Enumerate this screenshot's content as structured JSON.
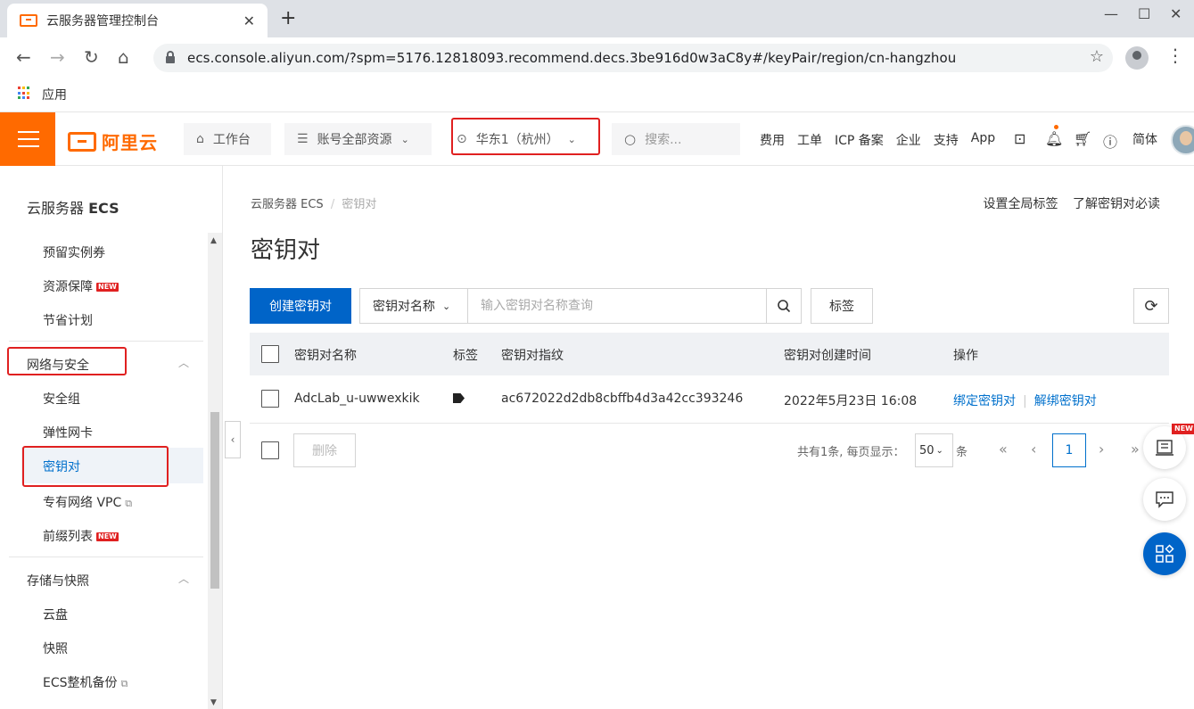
{
  "browser": {
    "tab_title": "云服务器管理控制台",
    "tab_close": "✕",
    "new_tab": "+",
    "url": "ecs.console.aliyun.com/?spm=5176.12818093.recommend.decs.3be916d0w3aC8y#/keyPair/region/cn-hangzhou",
    "bookmark_apps": "应用"
  },
  "topnav": {
    "logo_text": "阿里云",
    "workbench": "工作台",
    "resources": "账号全部资源",
    "region": "华东1（杭州）",
    "search_placeholder": "搜索...",
    "links": [
      "费用",
      "工单",
      "ICP 备案",
      "企业",
      "支持",
      "App"
    ],
    "lang": "简体"
  },
  "sidebar": {
    "title_prefix": "云服务器",
    "title_bold": "ECS",
    "items": {
      "reserved": "预留实例券",
      "resource_guarantee": "资源保障",
      "saving_plan": "节省计划",
      "network_security": "网络与安全",
      "security_group": "安全组",
      "eni": "弹性网卡",
      "key_pair": "密钥对",
      "vpc": "专有网络 VPC",
      "prefix_list": "前缀列表",
      "storage": "存储与快照",
      "disk": "云盘",
      "snapshot": "快照",
      "ecs_backup": "ECS整机备份"
    },
    "new_badge": "NEW"
  },
  "main": {
    "breadcrumb_root": "云服务器 ECS",
    "breadcrumb_sep": "/",
    "breadcrumb_current": "密钥对",
    "top_link_1": "设置全局标签",
    "top_link_2": "了解密钥对必读",
    "page_title": "密钥对",
    "create_button": "创建密钥对",
    "search_field": "密钥对名称",
    "search_placeholder": "输入密钥对名称查询",
    "tag_button": "标签",
    "refresh_icon": "⟳",
    "columns": {
      "name": "密钥对名称",
      "tag": "标签",
      "fingerprint": "密钥对指纹",
      "created": "密钥对创建时间",
      "actions": "操作"
    },
    "rows": [
      {
        "name": "AdcLab_u-uwwexkik",
        "fingerprint": "ac672022d2db8cbffb4d3a42cc393246",
        "created": "2022年5月23日 16:08",
        "bind": "绑定密钥对",
        "unbind": "解绑密钥对"
      }
    ],
    "delete_button": "删除",
    "pagination": {
      "summary": "共有1条, 每页显示：",
      "page_size": "50",
      "unit": "条",
      "current_page": "1"
    }
  },
  "float": {
    "new_badge": "NEW"
  },
  "colors": {
    "brand_orange": "#ff6a00",
    "primary_blue": "#0064c8",
    "highlight_red": "#e02020"
  }
}
